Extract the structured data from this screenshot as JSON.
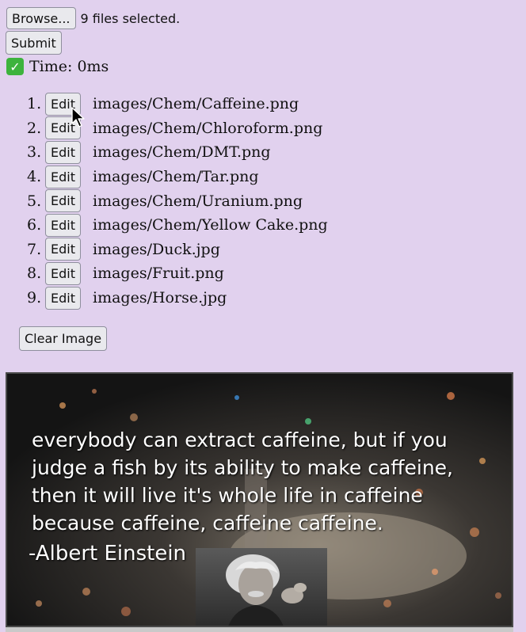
{
  "upload": {
    "browse_label": "Browse...",
    "status": "9 files selected."
  },
  "submit_label": "Submit",
  "timing": {
    "text": "Time: 0ms",
    "icon": "check-mark-icon"
  },
  "files": [
    {
      "number": "1.",
      "edit_label": "Edit",
      "path": "images/Chem/Caffeine.png"
    },
    {
      "number": "2.",
      "edit_label": "Edit",
      "path": "images/Chem/Chloroform.png"
    },
    {
      "number": "3.",
      "edit_label": "Edit",
      "path": "images/Chem/DMT.png"
    },
    {
      "number": "4.",
      "edit_label": "Edit",
      "path": "images/Chem/Tar.png"
    },
    {
      "number": "5.",
      "edit_label": "Edit",
      "path": "images/Chem/Uranium.png"
    },
    {
      "number": "6.",
      "edit_label": "Edit",
      "path": "images/Chem/Yellow Cake.png"
    },
    {
      "number": "7.",
      "edit_label": "Edit",
      "path": "images/Duck.jpg"
    },
    {
      "number": "8.",
      "edit_label": "Edit",
      "path": "images/Fruit.png"
    },
    {
      "number": "9.",
      "edit_label": "Edit",
      "path": "images/Horse.jpg"
    }
  ],
  "clear_label": "Clear Image",
  "preview": {
    "quote": "everybody can extract caffeine, but if you judge a fish by its ability to make caffeine, then it will live it's whole life in caffeine because caffeine, caffeine caffeine.",
    "author": "-Albert Einstein"
  },
  "colors": {
    "page_background": "#e1d1ee",
    "button_background": "#e9e9ed",
    "check_green": "#3db33d"
  }
}
